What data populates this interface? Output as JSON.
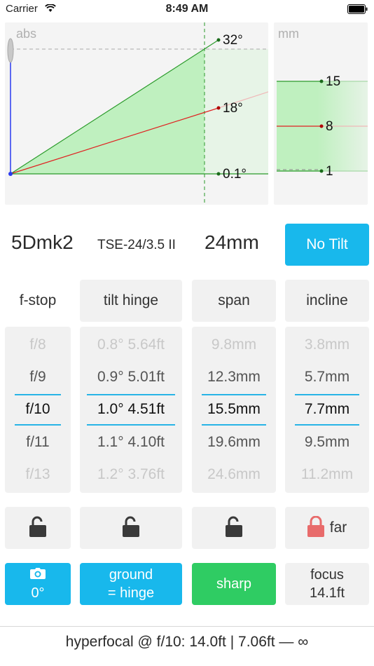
{
  "status": {
    "carrier": "Carrier",
    "time": "8:49 AM"
  },
  "diagram": {
    "mode_label": "abs",
    "angles": {
      "top": "32°",
      "mid": "18°",
      "low": "0.1°"
    }
  },
  "mm_panel": {
    "unit_label": "mm",
    "values": {
      "top": "15",
      "mid": "8",
      "low": "1"
    }
  },
  "camera": {
    "body": "5Dmk2",
    "lens": "TSE-24/3.5 II",
    "focal_length": "24mm"
  },
  "no_tilt_label": "No Tilt",
  "columns": {
    "fstop": {
      "header": "f-stop",
      "rows": [
        "f/8",
        "f/9",
        "f/10",
        "f/11",
        "f/13"
      ]
    },
    "tilt": {
      "header": "tilt  hinge",
      "rows": [
        "0.8° 5.64ft",
        "0.9° 5.01ft",
        "1.0° 4.51ft",
        "1.1° 4.10ft",
        "1.2° 3.76ft"
      ]
    },
    "span": {
      "header": "span",
      "rows": [
        "9.8mm",
        "12.3mm",
        "15.5mm",
        "19.6mm",
        "24.6mm"
      ]
    },
    "incline": {
      "header": "incline",
      "rows": [
        "3.8mm",
        "5.7mm",
        "7.7mm",
        "9.5mm",
        "11.2mm"
      ]
    }
  },
  "locks": {
    "far_label": "far"
  },
  "actions": {
    "camera_angle": "0°",
    "ground_line1": "ground",
    "ground_line2": "= hinge",
    "sharp": "sharp",
    "focus_line1": "focus",
    "focus_line2": "14.1ft"
  },
  "footer": {
    "hyperfocal": "hyperfocal @ f/10: 14.0ft | 7.06ft — ∞"
  },
  "colors": {
    "accent_blue": "#18b8ec",
    "sharp_green": "#2fcc63",
    "lock_red": "#e86b6b",
    "lock_dark": "#3a3a3a",
    "plane_green": "#2a9a2a",
    "plane_red": "#e02020"
  }
}
